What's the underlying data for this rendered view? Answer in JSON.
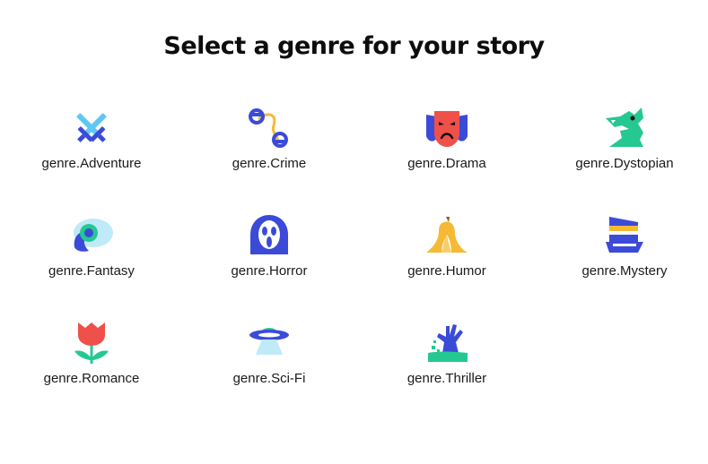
{
  "page": {
    "title": "Select a genre for your story"
  },
  "genres": [
    {
      "label": "genre.Adventure",
      "icon": "crossed-swords-icon"
    },
    {
      "label": "genre.Crime",
      "icon": "handcuffs-icon"
    },
    {
      "label": "genre.Drama",
      "icon": "drama-mask-icon"
    },
    {
      "label": "genre.Dystopian",
      "icon": "dragon-head-icon"
    },
    {
      "label": "genre.Fantasy",
      "icon": "eye-orb-icon"
    },
    {
      "label": "genre.Horror",
      "icon": "ghost-mask-icon"
    },
    {
      "label": "genre.Humor",
      "icon": "banana-peel-icon"
    },
    {
      "label": "genre.Mystery",
      "icon": "detective-hat-icon"
    },
    {
      "label": "genre.Romance",
      "icon": "rose-icon"
    },
    {
      "label": "genre.Sci-Fi",
      "icon": "ufo-icon"
    },
    {
      "label": "genre.Thriller",
      "icon": "zombie-hand-icon"
    }
  ],
  "colors": {
    "blue": "#3b4bd8",
    "light_blue": "#5fc8f2",
    "green": "#25c890",
    "red": "#f0504a",
    "yellow": "#f5b935"
  }
}
